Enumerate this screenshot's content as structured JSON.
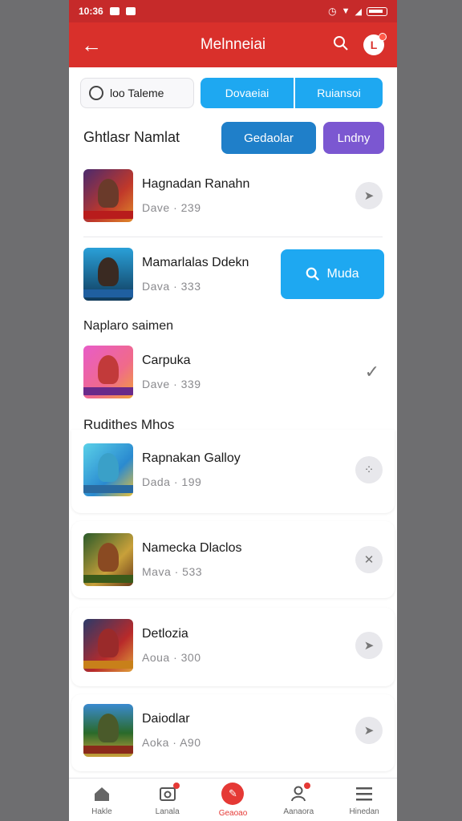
{
  "status": {
    "time": "10:36"
  },
  "appbar": {
    "title": "Melnneiai"
  },
  "filters": {
    "chip_label": "loo Taleme",
    "tabs": [
      "Dovaeiai",
      "Ruiansoi"
    ]
  },
  "section1": {
    "title": "Ghtlasr Namlat",
    "primary_button": "Gedaolar",
    "secondary_button": "Lndny"
  },
  "search_button": {
    "label": "Muda"
  },
  "section2": {
    "title": "Naplaro saimen"
  },
  "section3": {
    "title": "Rudithes Mhos"
  },
  "items": [
    {
      "name": "Hagnadan Ranahn",
      "sub": "Dave · 239",
      "action": "send-icon"
    },
    {
      "name": "Mamarlalas Ddekn",
      "sub": "Dava · 333",
      "action": "search-button"
    },
    {
      "name": "Carpuka",
      "sub": "Dave · 339",
      "action": "check-icon"
    },
    {
      "name": "Rapnakan Galloy",
      "sub": "Dada · 199",
      "action": "dots-icon"
    },
    {
      "name": "Namecka Dlaclos",
      "sub": "Mava · 533",
      "action": "close-icon"
    },
    {
      "name": "Detlozia",
      "sub": "Aoua · 300",
      "action": "send-icon"
    },
    {
      "name": "Daiodlar",
      "sub": "Aoka · A90",
      "action": "send-icon"
    }
  ],
  "nav": [
    {
      "label": "Hakle",
      "icon": "home-icon"
    },
    {
      "label": "Lanala",
      "icon": "camera-icon"
    },
    {
      "label": "Geaoao",
      "icon": "add-icon"
    },
    {
      "label": "Aanaora",
      "icon": "profile-icon"
    },
    {
      "label": "Hinedan",
      "icon": "menu-icon"
    }
  ],
  "colors": {
    "primary": "#d9302b",
    "accent": "#1ea8f1",
    "dark_blue": "#1f7fc9",
    "purple": "#7b57d1"
  }
}
